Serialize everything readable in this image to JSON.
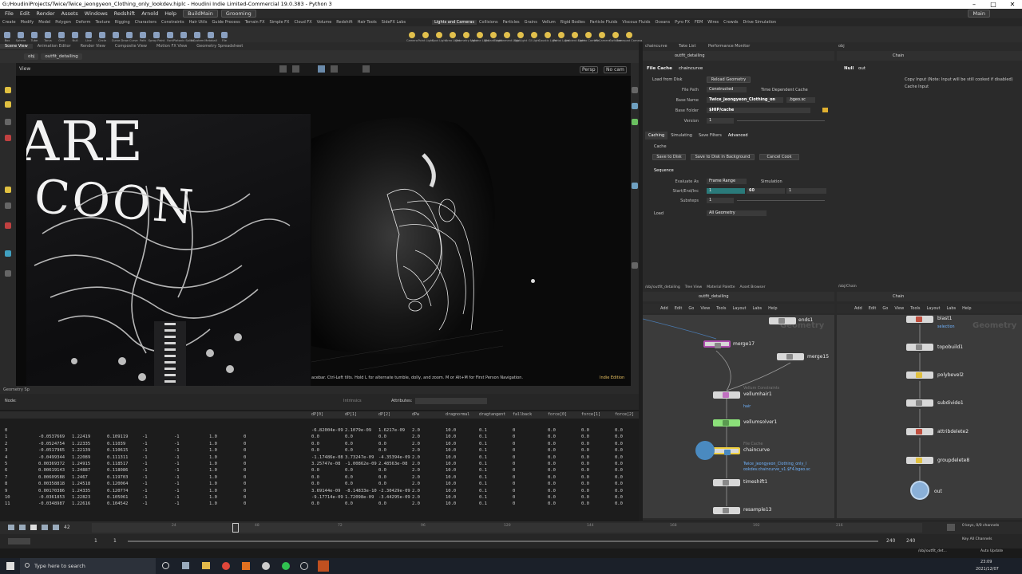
{
  "window": {
    "title": "G:/HoudiniProjects/Twice/Twice_jeongyeon_Clothing_only_lookdev.hiplc - Houdini Indie Limited-Commercial 19.0.383 - Python 3",
    "controls": [
      "–",
      "□",
      "✕"
    ]
  },
  "menubar": {
    "items": [
      "File",
      "Edit",
      "Render",
      "Assets",
      "Windows",
      "Redshift",
      "Arnold",
      "Help"
    ],
    "desktop": "BuildMain",
    "context": "Grooming",
    "main": "Main"
  },
  "shelf": {
    "tabs_left": [
      "Create",
      "Modify",
      "Model",
      "Polygon",
      "Deform",
      "Texture",
      "Rigging",
      "Characters",
      "Constraints",
      "Hair Utils",
      "Guide Process",
      "Terrain FX",
      "Simple FX",
      "Cloud FX",
      "Volume",
      "Redshift",
      "Hair Tools",
      "SideFX Labs"
    ],
    "tabs_right": [
      "Lights and Cameras",
      "Collisions",
      "Particles",
      "Grains",
      "Vellum",
      "Rigid Bodies",
      "Particle Fluids",
      "Viscous Fluids",
      "Oceans",
      "Pyro FX",
      "FEM",
      "Wires",
      "Crowds",
      "Drive Simulation"
    ],
    "tools_left": [
      "Box",
      "Sphere",
      "Tube",
      "Torus",
      "Grid",
      "Null",
      "Line",
      "Circle",
      "Curve",
      "Draw Curve",
      "Path",
      "Spray Paint",
      "Font",
      "Platonic Solids",
      "L-System",
      "Metaball",
      "File"
    ],
    "tools_right": [
      "Camera",
      "Point Light",
      "Spot Light",
      "Area Light",
      "Geometry Light",
      "Volume Light",
      "Distant Light",
      "Environment Light",
      "Sky Light",
      "GI Light",
      "Caustic Light",
      "Portal Light",
      "Ambient Light",
      "Stereo Camera",
      "VR Camera",
      "Switcher",
      "Gamepad Camera"
    ]
  },
  "left_pane": {
    "tabs": [
      "Scene View",
      "Animation Editor",
      "Render View",
      "Composite View",
      "Motion FX View",
      "Geometry Spreadsheet"
    ],
    "path": [
      "obj",
      "outfit_detailing"
    ],
    "view_label": "View",
    "persp": "Persp",
    "cam": "No cam",
    "hint": "acebar. Ctrl-Left tilts. Hold L for alternate tumble, dolly, and zoom.   M or Alt+M for First Person Navigation.",
    "edition": "Indie Edition"
  },
  "photo": {
    "text_top": "ARE",
    "text_bottom": "COON"
  },
  "spreadsheet": {
    "tab": "Geometry Sp",
    "node_label": "Node:",
    "intrinsics": "Intrinsics",
    "attributes": "Attributes:",
    "columns": [
      "dP[0]",
      "dP[1]",
      "dP[2]",
      "dPw",
      "dragnormal",
      "dragtangent",
      "fallback",
      "force[0]",
      "force[1]",
      "force[2]"
    ],
    "rows": [
      {
        "i": "0",
        "a": "",
        "b": "",
        "c": "",
        "d": "",
        "e": "",
        "f": "",
        "g": "",
        "v": [
          "-6.82004e-09",
          "2.1079e-09",
          "1.6217e-09",
          "2.0",
          "10.0",
          "0.1",
          "0",
          "0.0",
          "0.0",
          "0.0"
        ]
      },
      {
        "i": "1",
        "a": "-0.0537669",
        "b": "1.22419",
        "c": "0.109119",
        "d": "-1",
        "e": "-1",
        "f": "1.0",
        "g": "0",
        "v": [
          "0.0",
          "0.0",
          "0.0",
          "2.0",
          "10.0",
          "0.1",
          "0",
          "0.0",
          "0.0",
          "0.0"
        ]
      },
      {
        "i": "2",
        "a": "-0.0524754",
        "b": "1.22335",
        "c": "0.11039",
        "d": "-1",
        "e": "-1",
        "f": "1.0",
        "g": "0",
        "v": [
          "0.0",
          "0.0",
          "0.0",
          "2.0",
          "10.0",
          "0.1",
          "0",
          "0.0",
          "0.0",
          "0.0"
        ]
      },
      {
        "i": "3",
        "a": "-0.0517965",
        "b": "1.22139",
        "c": "0.110615",
        "d": "-1",
        "e": "-1",
        "f": "1.0",
        "g": "0",
        "v": [
          "0.0",
          "0.0",
          "0.0",
          "2.0",
          "10.0",
          "0.1",
          "0",
          "0.0",
          "0.0",
          "0.0"
        ]
      },
      {
        "i": "4",
        "a": "-0.0499344",
        "b": "1.22089",
        "c": "0.111311",
        "d": "-1",
        "e": "-1",
        "f": "1.0",
        "g": "0",
        "v": [
          "-1.17486e-08",
          "3.73247e-09",
          "-4.35394e-09",
          "2.0",
          "10.0",
          "0.1",
          "0",
          "0.0",
          "0.0",
          "0.0"
        ]
      },
      {
        "i": "5",
        "a": "0.00369372",
        "b": "1.24915",
        "c": "0.118517",
        "d": "-1",
        "e": "-1",
        "f": "1.0",
        "g": "0",
        "v": [
          "3.25747e-08",
          "-1.00862e-09",
          "2.48563e-08",
          "2.0",
          "10.0",
          "0.1",
          "0",
          "0.0",
          "0.0",
          "0.0"
        ]
      },
      {
        "i": "6",
        "a": "0.00619143",
        "b": "1.24887",
        "c": "0.118086",
        "d": "-1",
        "e": "-1",
        "f": "1.0",
        "g": "0",
        "v": [
          "0.0",
          "0.0",
          "0.0",
          "2.0",
          "10.0",
          "0.1",
          "0",
          "0.0",
          "0.0",
          "0.0"
        ]
      },
      {
        "i": "7",
        "a": "0.00609588",
        "b": "1.2467",
        "c": "0.119703",
        "d": "-1",
        "e": "-1",
        "f": "1.0",
        "g": "0",
        "v": [
          "0.0",
          "0.0",
          "0.0",
          "2.0",
          "10.0",
          "0.1",
          "0",
          "0.0",
          "0.0",
          "0.0"
        ]
      },
      {
        "i": "8",
        "a": "0.00358818",
        "b": "1.24518",
        "c": "0.120064",
        "d": "-1",
        "e": "-1",
        "f": "1.0",
        "g": "0",
        "v": [
          "0.0",
          "0.0",
          "0.0",
          "2.0",
          "10.0",
          "0.1",
          "0",
          "0.0",
          "0.0",
          "0.0"
        ]
      },
      {
        "i": "9",
        "a": "0.00170386",
        "b": "1.24335",
        "c": "0.120774",
        "d": "-1",
        "e": "-1",
        "f": "1.0",
        "g": "0",
        "v": [
          "3.69144e-09",
          "-8.14833e-10",
          "-2.30429e-09",
          "2.0",
          "10.0",
          "0.1",
          "0",
          "0.0",
          "0.0",
          "0.0"
        ]
      },
      {
        "i": "10",
        "a": "-0.0361853",
        "b": "1.22823",
        "c": "0.105061",
        "d": "-1",
        "e": "-1",
        "f": "1.0",
        "g": "0",
        "v": [
          "-9.17714e-09",
          "1.72098e-09",
          "-3.44295e-09",
          "2.0",
          "10.0",
          "0.1",
          "0",
          "0.0",
          "0.0",
          "0.0"
        ]
      },
      {
        "i": "11",
        "a": "-0.0348987",
        "b": "1.22616",
        "c": "0.104542",
        "d": "-1",
        "e": "-1",
        "f": "1.0",
        "g": "0",
        "v": [
          "0.0",
          "0.0",
          "0.0",
          "2.0",
          "10.0",
          "0.1",
          "0",
          "0.0",
          "0.0",
          "0.0"
        ]
      }
    ]
  },
  "timeline": {
    "frame": "42",
    "ticks": [
      "24",
      "48",
      "72",
      "96",
      "120",
      "144",
      "168",
      "192",
      "216"
    ],
    "start": "1",
    "start2": "1",
    "end": "240",
    "end2": "240",
    "keys": "0 keys, 0/0 channels",
    "key_all": "Key All Channels",
    "path": "/obj/outfit_det...",
    "auto_update": "Auto Update"
  },
  "params": {
    "tabs": [
      "outfit_detailing",
      "Take List",
      "Performance Monitor"
    ],
    "node_type": "File Cache",
    "node_name": "chaincurve",
    "load_from_disk": "Load from Disk",
    "reload_geometry": "Reload Geometry",
    "file_path_label": "File Path",
    "file_path_value": "Constructed",
    "time_dependent": "Time Dependent Cache",
    "base_name_label": "Base Name",
    "base_name_value": "Twice_jeongyeon_Clothing_on",
    "ext": ".bgeo.sc",
    "base_folder_label": "Base Folder",
    "base_folder_value": "$HIP/cache",
    "version_label": "Version",
    "version_value": "1",
    "sub_tabs": [
      "Caching",
      "Simulating",
      "Save Filters",
      "Advanced"
    ],
    "cache_section": "Cache",
    "save_to_disk": "Save to Disk",
    "save_bg": "Save to Disk in Background",
    "cancel_cook": "Cancel Cook",
    "sequence_section": "Sequence",
    "evaluate_as_label": "Evaluate As",
    "evaluate_as_value": "Frame Range",
    "simulation": "Simulation",
    "start_end_label": "Start/End/Inc",
    "start_val": "1",
    "end_val": "60",
    "inc_val": "1",
    "substeps_label": "Substeps",
    "substeps_val": "1",
    "load_section": "Load",
    "load_value": "All Geometry"
  },
  "null_params": {
    "tab": "obj",
    "path": "Chain",
    "node_type": "Null",
    "node_name": "out",
    "copy_input": "Copy Input (Note: Input will be still cooked if disabled)",
    "cache_input": "Cache Input"
  },
  "network_left": {
    "tabs": [
      "/obj/outfit_detailing",
      "Tree View",
      "Material Palette",
      "Asset Browser"
    ],
    "path": "outfit_detailing",
    "menu": [
      "Add",
      "Edit",
      "Go",
      "View",
      "Tools",
      "Layout",
      "Labs",
      "Help"
    ],
    "watermark": "Geometry",
    "nodes": [
      {
        "name": "ends1",
        "sub": ""
      },
      {
        "name": "merge17",
        "sub": ""
      },
      {
        "name": "merge15",
        "sub": ""
      },
      {
        "name": "vellumhair1",
        "sub": "hair",
        "type": "Vellum Constraints"
      },
      {
        "name": "vellumsolver1",
        "sub": ""
      },
      {
        "name": "chaincurve",
        "sub": "Twice_jeongyeon_Clothing_only_l ookdev.chaincurve_v1.$F4.bgeo.sc",
        "type": "File Cache"
      },
      {
        "name": "timeshift1",
        "sub": ""
      },
      {
        "name": "resample13",
        "sub": ""
      }
    ]
  },
  "network_right": {
    "tab": "/obj/Chain",
    "path": "Chain",
    "menu": [
      "Add",
      "Edit",
      "Go",
      "View",
      "Tools",
      "Layout",
      "Labs",
      "Help"
    ],
    "watermark": "Geometry",
    "nodes": [
      {
        "name": "blast1",
        "sub": "selection"
      },
      {
        "name": "topobuild1",
        "sub": ""
      },
      {
        "name": "polybevel2",
        "sub": ""
      },
      {
        "name": "subdivide1",
        "sub": ""
      },
      {
        "name": "attribdelete2",
        "sub": ""
      },
      {
        "name": "groupdelete8",
        "sub": ""
      },
      {
        "name": "out",
        "sub": ""
      }
    ]
  },
  "taskbar": {
    "search": "Type here to search",
    "time": "23:09",
    "date": "2021/12/07"
  },
  "colors": {
    "accent": "#2a7a7a",
    "node_green": "#8ce07a",
    "selected_outline": "#f0d040",
    "link_blue": "#6fb3ff"
  }
}
